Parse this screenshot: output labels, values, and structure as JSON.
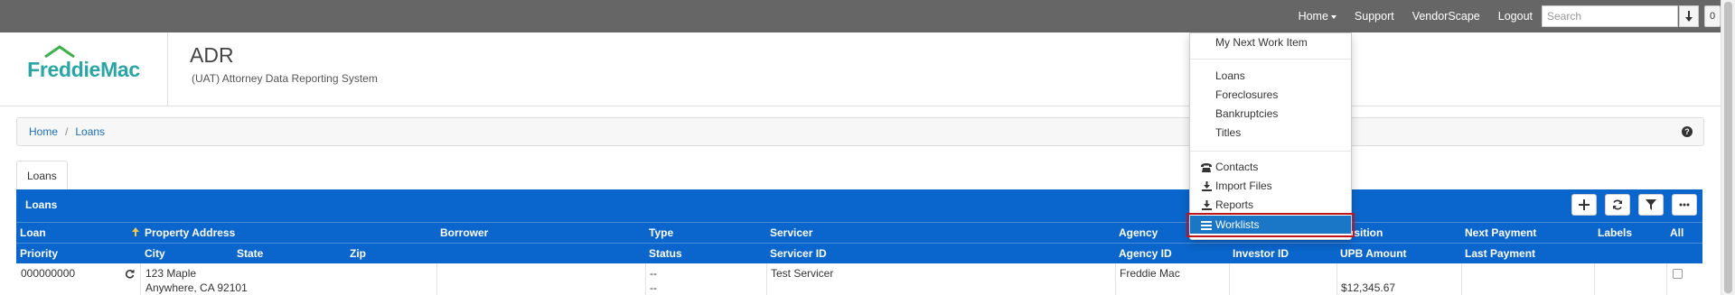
{
  "topnav": {
    "home_label": "Home",
    "support_label": "Support",
    "vendorscape_label": "VendorScape",
    "logout_label": "Logout",
    "search_placeholder": "Search",
    "badge_count": "0"
  },
  "header": {
    "logo_part1": "Freddie",
    "logo_part2": "Mac",
    "app_title": "ADR",
    "app_subtitle": "(UAT) Attorney Data Reporting System"
  },
  "breadcrumb": {
    "items": [
      "Home",
      "Loans"
    ]
  },
  "tabs": [
    {
      "label": "Loans"
    }
  ],
  "panel": {
    "title": "Loans"
  },
  "table": {
    "header_row1": [
      "Loan",
      "Property Address",
      "Borrower",
      "Type",
      "Servicer",
      "Agency",
      "Position",
      "Next Payment",
      "Labels",
      "All"
    ],
    "header_row2": [
      "Priority",
      "City",
      "State",
      "Zip",
      "Status",
      "Servicer ID",
      "Agency ID",
      "Investor ID",
      "UPB Amount",
      "Last Payment"
    ],
    "rows": [
      {
        "loan": "000000000",
        "address_line1": "123 Maple",
        "address_line2": "Anywhere, CA 92101",
        "type": "--",
        "status": "--",
        "servicer": "Test Servicer",
        "agency": "Freddie Mac",
        "upb_amount": "$12,345.67"
      }
    ]
  },
  "home_menu": {
    "items": [
      {
        "label": "My Next Work Item",
        "icon": ""
      },
      {
        "label": "Loans",
        "icon": ""
      },
      {
        "label": "Foreclosures",
        "icon": ""
      },
      {
        "label": "Bankruptcies",
        "icon": ""
      },
      {
        "label": "Titles",
        "icon": ""
      },
      {
        "label": "Contacts",
        "icon": "phone-icon"
      },
      {
        "label": "Import Files",
        "icon": "import-icon"
      },
      {
        "label": "Reports",
        "icon": "report-icon"
      },
      {
        "label": "Worklists",
        "icon": "list-icon",
        "active": true
      }
    ]
  },
  "colors": {
    "topbar": "#666666",
    "panel_blue": "#0a66cc",
    "link_blue": "#1a6fb8",
    "brand_teal": "#2aa5a5",
    "highlight_red": "#c0141f"
  }
}
